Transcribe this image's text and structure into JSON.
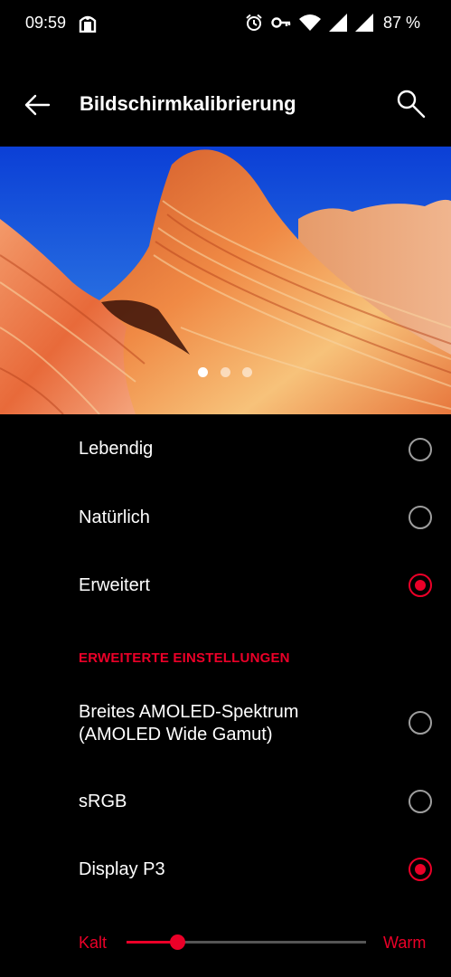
{
  "status_bar": {
    "time": "09:59",
    "battery": "87 %",
    "icons": [
      "notification-icon",
      "alarm-icon",
      "vpn-key-icon",
      "wifi-icon",
      "signal-icon",
      "signal-icon",
      "battery-icon"
    ]
  },
  "app_bar": {
    "title": "Bildschirmkalibrierung",
    "back_icon": "arrow-back-icon",
    "search_icon": "search-icon"
  },
  "banner": {
    "pages": 3,
    "active_page": 1
  },
  "modes": [
    {
      "label": "Lebendig",
      "selected": false
    },
    {
      "label": "Natürlich",
      "selected": false
    },
    {
      "label": "Erweitert",
      "selected": true
    }
  ],
  "advanced": {
    "header": "ERWEITERTE EINSTELLUNGEN",
    "options": [
      {
        "label_line1": "Breites AMOLED-Spektrum",
        "label_line2": "(AMOLED Wide Gamut)",
        "selected": false
      },
      {
        "label_line1": "sRGB",
        "selected": false
      },
      {
        "label_line1": "Display P3",
        "selected": true
      }
    ]
  },
  "temperature_slider": {
    "min_label": "Kalt",
    "max_label": "Warm",
    "value": 0.21
  },
  "colors": {
    "accent": "#eb0028",
    "background": "#000000",
    "radio_unchecked": "#9e9e9e"
  }
}
